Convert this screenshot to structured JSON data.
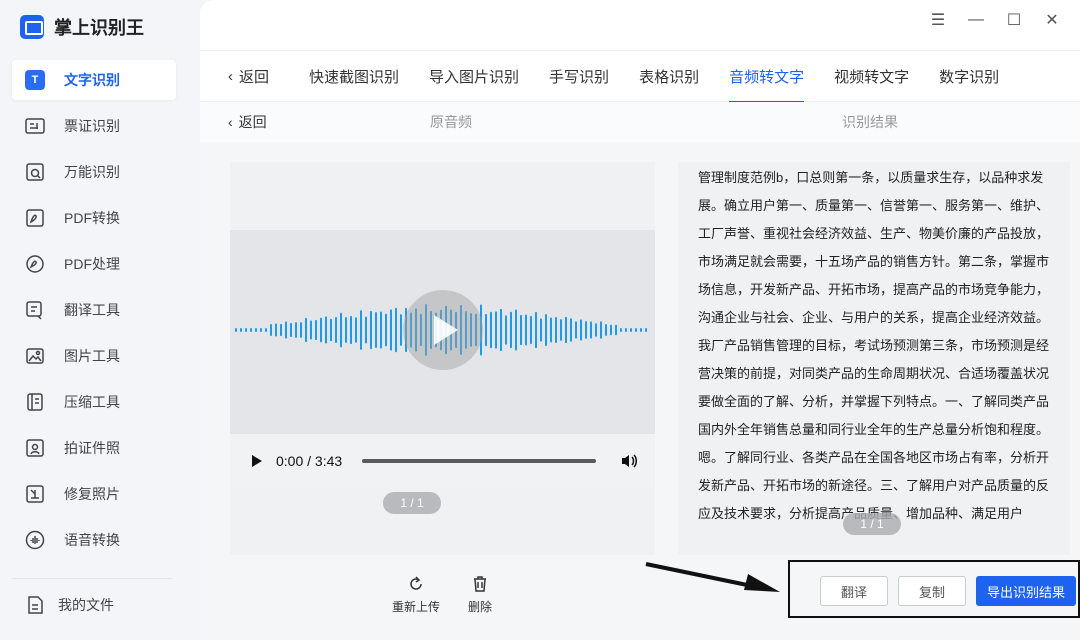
{
  "app": {
    "name": "掌上识别王"
  },
  "sidebar": {
    "items": [
      {
        "label": "文字识别",
        "icon": "text-recognition-icon",
        "active": true
      },
      {
        "label": "票证识别",
        "icon": "ticket-icon"
      },
      {
        "label": "万能识别",
        "icon": "universal-scan-icon"
      },
      {
        "label": "PDF转换",
        "icon": "pdf-convert-icon"
      },
      {
        "label": "PDF处理",
        "icon": "pdf-process-icon"
      },
      {
        "label": "翻译工具",
        "icon": "translate-icon"
      },
      {
        "label": "图片工具",
        "icon": "image-tool-icon"
      },
      {
        "label": "压缩工具",
        "icon": "compress-icon"
      },
      {
        "label": "拍证件照",
        "icon": "id-photo-icon"
      },
      {
        "label": "修复照片",
        "icon": "repair-photo-icon"
      },
      {
        "label": "语音转换",
        "icon": "voice-convert-icon"
      }
    ],
    "my_files": "我的文件",
    "active_badge": "T"
  },
  "tabs": {
    "back": "返回",
    "items": [
      "快速截图识别",
      "导入图片识别",
      "手写识别",
      "表格识别",
      "音频转文字",
      "视频转文字",
      "数字识别"
    ],
    "active_index": 4
  },
  "subbar": {
    "back": "返回",
    "left_title": "原音频",
    "right_title": "识别结果"
  },
  "player": {
    "time": "0:00 / 3:43"
  },
  "pager": {
    "left": "1 / 1",
    "right": "1 / 1"
  },
  "result_text": "管理制度范例b，口总则第一条，以质量求生存，以品种求发展。确立用户第一、质量第一、信誉第一、服务第一、维护、工厂声誉、重视社会经济效益、生产、物美价廉的产品投放，市场满足就会需要，十五场产品的销售方针。第二条，掌握市场信息，开发新产品、开拓市场，提高产品的市场竞争能力，沟通企业与社会、企业、与用户的关系，提高企业经济效益。我厂产品销售管理的目标，考试场预测第三条，市场预测是经营决策的前提，对同类产品的生命周期状况、合适场覆盖状况要做全面的了解、分析，并掌握下列特点。一、了解同类产品国内外全年销售总量和同行业全年的生产总量分析饱和程度。嗯。了解同行业、各类产品在全国各地区市场占有率，分析开发新产品、开拓市场的新途径。三、了解用户对产品质量的反应及技术要求，分析提高产品质量、增加品种、满足用户",
  "actions": {
    "reupload": "重新上传",
    "delete": "删除"
  },
  "buttons": {
    "translate": "翻译",
    "copy": "复制",
    "export": "导出识别结果"
  },
  "colors": {
    "accent": "#1e63f0",
    "wave": "#1e9be8"
  }
}
